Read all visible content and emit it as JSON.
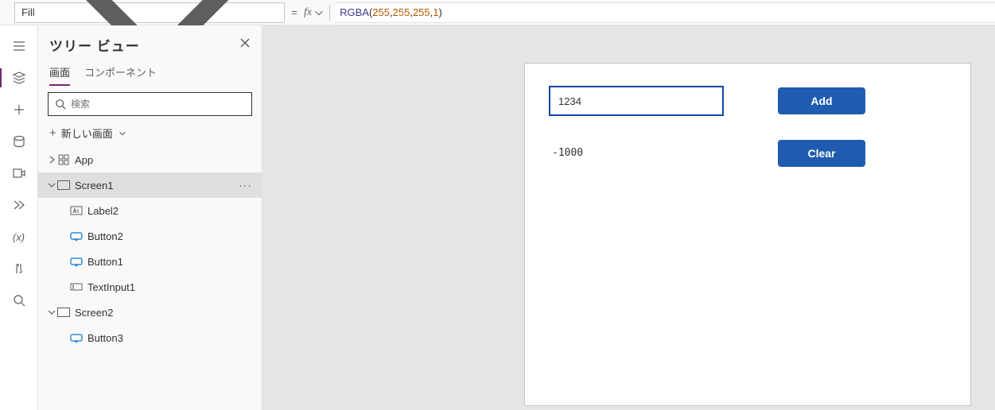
{
  "property_selector": {
    "value": "Fill"
  },
  "formula": {
    "fn": "RGBA",
    "args": [
      "255",
      "255",
      "255",
      "1"
    ]
  },
  "tree_view": {
    "title": "ツリー ビュー",
    "tabs": {
      "screens": "画面",
      "components": "コンポーネント"
    },
    "search_placeholder": "検索",
    "new_screen": "新しい画面",
    "app_label": "App",
    "nodes": {
      "screen1": "Screen1",
      "label2": "Label2",
      "button2": "Button2",
      "button1": "Button1",
      "textinput1": "TextInput1",
      "screen2": "Screen2",
      "button3": "Button3"
    }
  },
  "canvas": {
    "input_value": "1234",
    "label_value": "-1000",
    "btn_add": "Add",
    "btn_clear": "Clear"
  }
}
